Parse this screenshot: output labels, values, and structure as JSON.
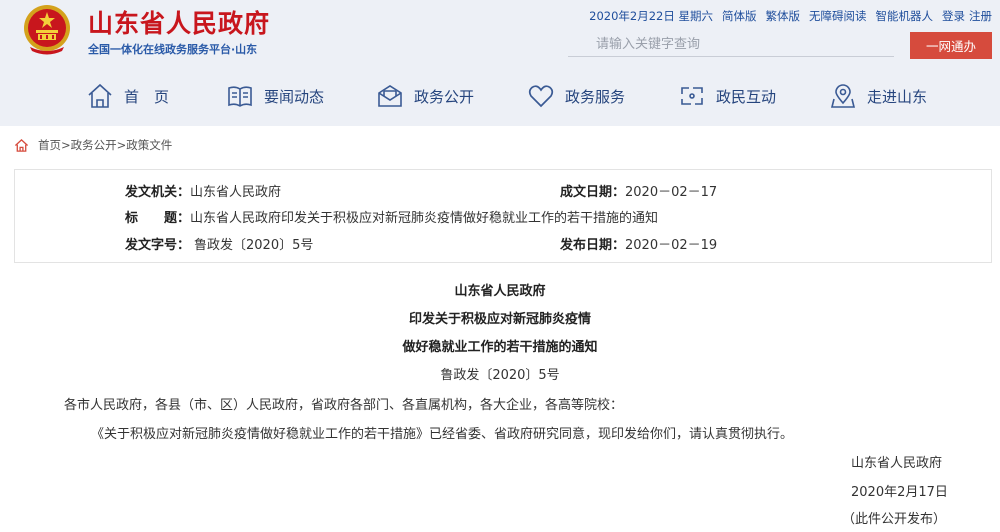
{
  "header": {
    "site_title": "山东省人民政府",
    "site_subtitle": "全国一体化在线政务服务平台·山东",
    "top_links": {
      "date": "2020年2月22日 星期六",
      "simplified": "简体版",
      "traditional": "繁体版",
      "accessibility": "无障碍阅读",
      "robot": "智能机器人",
      "login": "登录",
      "register": "注册"
    },
    "search": {
      "placeholder": "请输入关键字查询",
      "button": "一网通办"
    },
    "nav": [
      {
        "label": "首　页",
        "icon": "home-icon"
      },
      {
        "label": "要闻动态",
        "icon": "book-icon"
      },
      {
        "label": "政务公开",
        "icon": "envelope-icon"
      },
      {
        "label": "政务服务",
        "icon": "heart-icon"
      },
      {
        "label": "政民互动",
        "icon": "interaction-icon"
      },
      {
        "label": "走进山东",
        "icon": "map-pin-icon"
      }
    ]
  },
  "breadcrumb": [
    "首页",
    ">",
    "政务公开",
    ">",
    "政策文件"
  ],
  "meta": {
    "issuer_label": "发文机关：",
    "issuer": "山东省人民政府",
    "created_label": "成文日期：",
    "created": "2020－02－17",
    "title_label": "标　　题：",
    "title": "山东省人民政府印发关于积极应对新冠肺炎疫情做好稳就业工作的若干措施的通知",
    "doc_no_label": "发文字号：",
    "doc_no": "鲁政发〔2020〕5号",
    "published_label": "发布日期：",
    "published": "2020－02－19"
  },
  "document": {
    "title_1": "山东省人民政府",
    "title_2": "印发关于积极应对新冠肺炎疫情",
    "title_3": "做好稳就业工作的若干措施的通知",
    "doc_no": "鲁政发〔2020〕5号",
    "salutation": "各市人民政府，各县（市、区）人民政府，省政府各部门、各直属机构，各大企业，各高等院校：",
    "body": "《关于积极应对新冠肺炎疫情做好稳就业工作的若干措施》已经省委、省政府研究同意，现印发给你们，请认真贯彻执行。",
    "signature": "山东省人民政府",
    "sign_date": "2020年2月17日",
    "note": "（此件公开发布）"
  },
  "colors": {
    "brand_red": "#c8161d",
    "nav_blue": "#26457e",
    "button_red": "#d64b3d",
    "header_bg": "#edf0f6"
  }
}
